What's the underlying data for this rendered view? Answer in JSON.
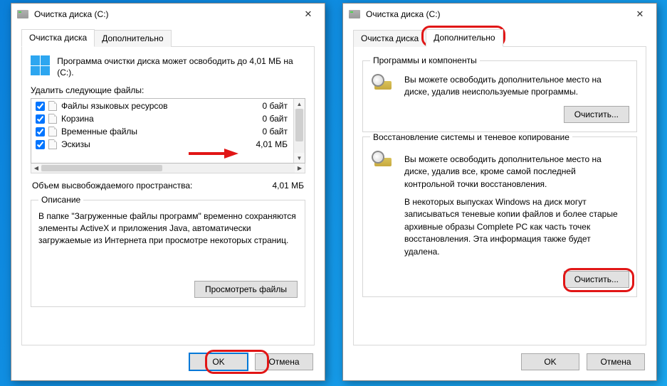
{
  "left": {
    "title": "Очистка диска  (C:)",
    "tabs": {
      "main": "Очистка диска",
      "advanced": "Дополнительно"
    },
    "info": "Программа очистки диска может освободить до 4,01 МБ на  (C:).",
    "delete_label": "Удалить следующие файлы:",
    "files": [
      {
        "name": "Файлы языковых ресурсов",
        "size": "0 байт",
        "checked": true
      },
      {
        "name": "Корзина",
        "size": "0 байт",
        "checked": true
      },
      {
        "name": "Временные файлы",
        "size": "0 байт",
        "checked": true
      },
      {
        "name": "Эскизы",
        "size": "4,01 МБ",
        "checked": true
      }
    ],
    "total_label": "Объем высвобождаемого пространства:",
    "total_value": "4,01 МБ",
    "desc_legend": "Описание",
    "desc_text": "В папке \"Загруженные файлы программ\" временно сохраняются элементы ActiveX и приложения Java, автоматически загружаемые из Интернета при просмотре некоторых страниц.",
    "view_files_btn": "Просмотреть файлы",
    "ok": "OK",
    "cancel": "Отмена"
  },
  "right": {
    "title": "Очистка диска  (C:)",
    "tabs": {
      "main": "Очистка диска",
      "advanced": "Дополнительно"
    },
    "programs_legend": "Программы и компоненты",
    "programs_text": "Вы можете освободить дополнительное место на диске, удалив неиспользуемые программы.",
    "restore_legend": "Восстановление системы и теневое копирование",
    "restore_text1": "Вы можете освободить дополнительное место на диске, удалив все, кроме самой последней контрольной точки восстановления.",
    "restore_text2": "В некоторых выпусках Windows на диск могут записываться теневые копии файлов и более старые архивные образы Complete PC как часть точек восстановления. Эта информация также будет удалена.",
    "clean_btn": "Очистить...",
    "ok": "OK",
    "cancel": "Отмена"
  }
}
